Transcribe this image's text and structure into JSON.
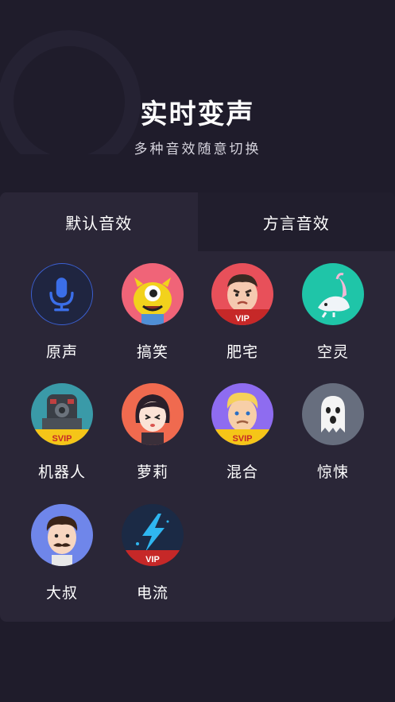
{
  "header": {
    "title": "实时变声",
    "subtitle": "多种音效随意切换"
  },
  "tabs": [
    {
      "label": "默认音效",
      "active": true
    },
    {
      "label": "方言音效",
      "active": false
    }
  ],
  "effects": [
    {
      "label": "原声",
      "icon": "microphone-icon",
      "badge": ""
    },
    {
      "label": "搞笑",
      "icon": "one-eyed-monster-icon",
      "badge": ""
    },
    {
      "label": "肥宅",
      "icon": "angry-man-icon",
      "badge": "VIP"
    },
    {
      "label": "空灵",
      "icon": "axolotl-icon",
      "badge": ""
    },
    {
      "label": "机器人",
      "icon": "robot-icon",
      "badge": "SVIP"
    },
    {
      "label": "萝莉",
      "icon": "girl-icon",
      "badge": ""
    },
    {
      "label": "混合",
      "icon": "blond-man-icon",
      "badge": "SVIP"
    },
    {
      "label": "惊悚",
      "icon": "ghost-icon",
      "badge": ""
    },
    {
      "label": "大叔",
      "icon": "mustache-man-icon",
      "badge": ""
    },
    {
      "label": "电流",
      "icon": "lightning-icon",
      "badge": "VIP"
    }
  ],
  "colors": {
    "background": "#1f1c2b",
    "panel": "#2a2637",
    "vip_badge": "#d32f2f",
    "svip_badge": "#f5c518",
    "mic_blue": "#3b6ee8"
  }
}
